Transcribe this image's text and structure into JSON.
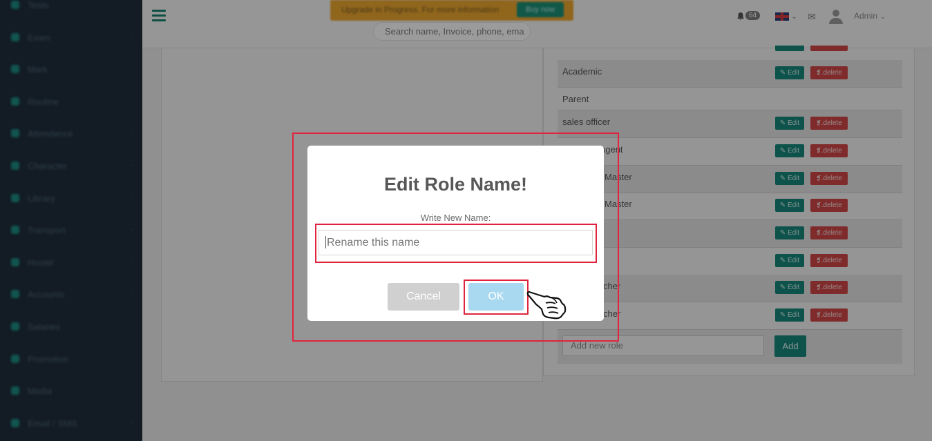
{
  "sidebar": {
    "items": [
      {
        "label": "Tests",
        "arrow": false
      },
      {
        "label": "Exam",
        "arrow": true
      },
      {
        "label": "Mark",
        "arrow": false
      },
      {
        "label": "Routine",
        "arrow": false
      },
      {
        "label": "Attendance",
        "arrow": true
      },
      {
        "label": "Character",
        "arrow": true
      },
      {
        "label": "Library",
        "arrow": true
      },
      {
        "label": "Transport",
        "arrow": true
      },
      {
        "label": "Hostel",
        "arrow": true
      },
      {
        "label": "Accounts",
        "arrow": true
      },
      {
        "label": "Salaries",
        "arrow": false
      },
      {
        "label": "Promotion",
        "arrow": false
      },
      {
        "label": "Media",
        "arrow": false
      },
      {
        "label": "Email / SMS",
        "arrow": true
      }
    ]
  },
  "header": {
    "upgrade_text": "Upgrade in Progress. For more information",
    "upgrade_button": "Buy now",
    "search_placeholder": "Search name, Invoice, phone, ema",
    "notification_count": "64",
    "user_name": "Admin"
  },
  "roles": {
    "rows": [
      {
        "name": "Academic",
        "has_actions": true,
        "shaded": true
      },
      {
        "name": "Parent",
        "has_actions": false,
        "shaded": false
      },
      {
        "name": "sales officer",
        "has_actions": true,
        "shaded": true
      },
      {
        "name": "agent",
        "has_actions": true,
        "shaded": false
      },
      {
        "name": "Master",
        "has_actions": true,
        "shaded": true
      },
      {
        "name": "Master",
        "has_actions": true,
        "shaded": false
      },
      {
        "name": "",
        "has_actions": true,
        "shaded": true
      },
      {
        "name": "",
        "has_actions": true,
        "shaded": false
      },
      {
        "name": "cher",
        "has_actions": true,
        "shaded": true
      },
      {
        "name": "cher",
        "has_actions": true,
        "shaded": false
      }
    ],
    "edit_label": "Edit",
    "delete_label": ".delete",
    "add_placeholder": "Add new role",
    "add_button": "Add"
  },
  "modal": {
    "title": "Edit Role Name!",
    "label": "Write New Name:",
    "input_placeholder": "Rename this name",
    "input_value": "",
    "cancel_label": "Cancel",
    "ok_label": "OK"
  },
  "colors": {
    "sidebar_bg": "#1f2d3b",
    "accent_teal": "#16857a",
    "delete_red": "#cf4646",
    "annotation_red": "#e0243d",
    "ok_button": "#a9d9f0",
    "cancel_button": "#d0d0d0"
  }
}
